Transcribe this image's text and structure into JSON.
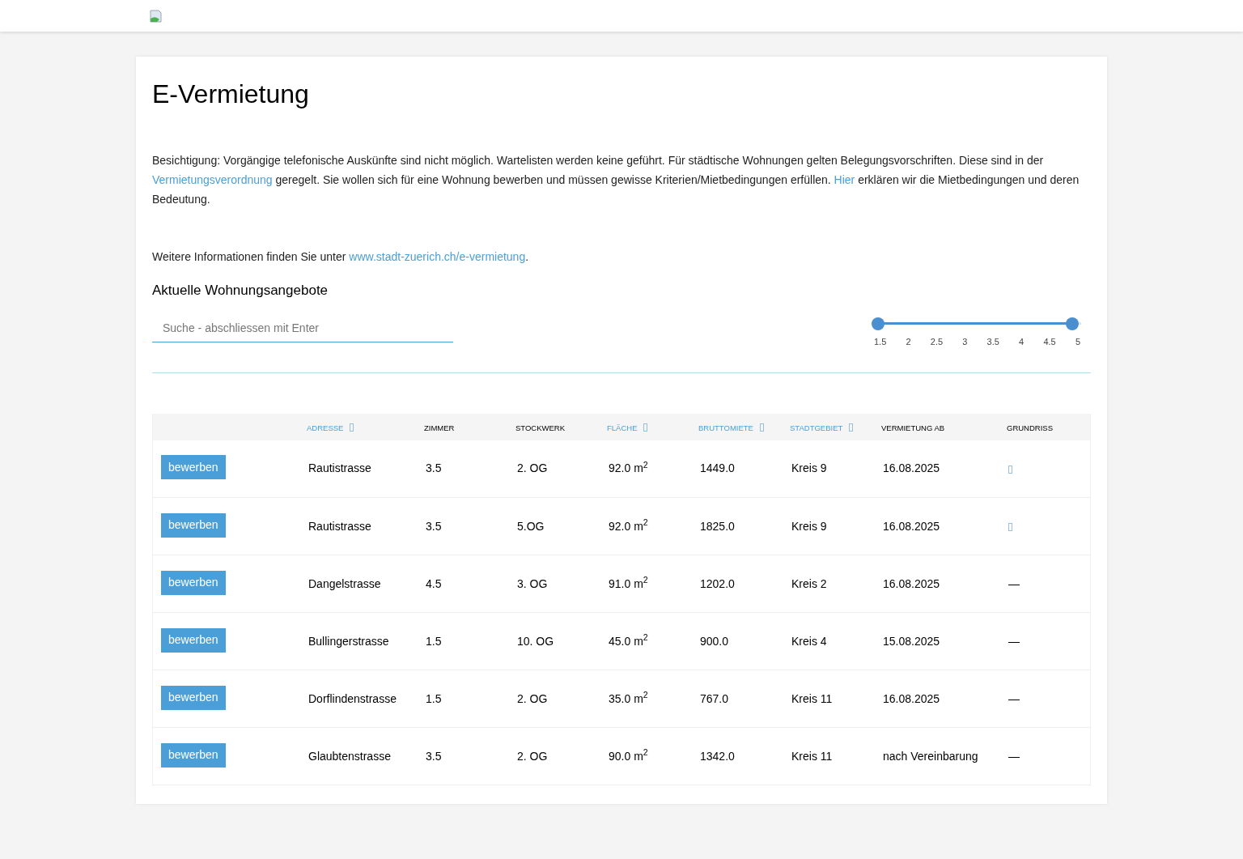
{
  "title": "E-Vermietung",
  "intro": [
    {
      "kind": "text",
      "text": "Besichtigung: Vorgängige telefonische Auskünfte sind nicht möglich. Wartelisten werden keine geführt. Für städtische Wohnungen gelten Belegungsvorschriften. Diese sind in der "
    },
    {
      "kind": "link",
      "text": "Vermietungsverordnung"
    },
    {
      "kind": "text",
      "text": " geregelt. Sie wollen sich für eine Wohnung bewerben und müssen gewisse Kriterien/Mietbedingungen erfüllen. "
    },
    {
      "kind": "link",
      "text": "Hier"
    },
    {
      "kind": "text",
      "text": " erklären wir die Mietbedingungen und deren Bedeutung."
    }
  ],
  "info": [
    {
      "kind": "text",
      "text": "Weitere Informationen finden Sie unter "
    },
    {
      "kind": "link",
      "text": "www.stadt-zuerich.ch/e-vermietung"
    },
    {
      "kind": "text",
      "text": "."
    }
  ],
  "section_title": "Aktuelle Wohnungsangebote",
  "search": {
    "placeholder": "Suche - abschliessen mit Enter"
  },
  "slider": {
    "low": {
      "level": 0
    },
    "high": {
      "level": 1
    },
    "ticks": [
      "1.5",
      "2",
      "2.5",
      "3",
      "3.5",
      "4",
      "4.5",
      "5"
    ]
  },
  "table": {
    "columns": [
      {
        "sortable": false
      },
      {
        "label": "ADRESSE",
        "sortable": true
      },
      {
        "label": "ZIMMER",
        "sortable": false
      },
      {
        "label": "STOCKWERK",
        "sortable": false
      },
      {
        "label": "FLÄCHE",
        "sortable": true
      },
      {
        "label": "BRUTTOMIETE",
        "sortable": true
      },
      {
        "label": "STADTGEBIET",
        "sortable": true
      },
      {
        "label": "VERMIETUNG AB",
        "sortable": false
      },
      {
        "label": "GRUNDRISS",
        "sortable": false
      }
    ],
    "rows": [
      {
        "cells": [
          {
            "kind": "button",
            "text": "bewerben"
          },
          {
            "kind": "text",
            "text": "Rautistrasse"
          },
          {
            "kind": "text",
            "text": "3.5"
          },
          {
            "kind": "text",
            "text": "2. OG"
          },
          {
            "kind": "text",
            "text": "92.0 m$^{2}$"
          },
          {
            "kind": "text",
            "text": "1449.0"
          },
          {
            "kind": "text",
            "text": "Kreis 9"
          },
          {
            "kind": "text",
            "text": "16.08.2025"
          },
          {
            "kind": "icon"
          }
        ]
      },
      {
        "cells": [
          {
            "kind": "button",
            "text": "bewerben"
          },
          {
            "kind": "text",
            "text": "Rautistrasse"
          },
          {
            "kind": "text",
            "text": "3.5"
          },
          {
            "kind": "text",
            "text": "5.OG"
          },
          {
            "kind": "text",
            "text": "92.0 m$^{2}$"
          },
          {
            "kind": "text",
            "text": "1825.0"
          },
          {
            "kind": "text",
            "text": "Kreis 9"
          },
          {
            "kind": "text",
            "text": "16.08.2025"
          },
          {
            "kind": "icon"
          }
        ]
      },
      {
        "cells": [
          {
            "kind": "button",
            "text": "bewerben"
          },
          {
            "kind": "text",
            "text": "Dangelstrasse"
          },
          {
            "kind": "text",
            "text": "4.5"
          },
          {
            "kind": "text",
            "text": "3. OG"
          },
          {
            "kind": "text",
            "text": "91.0 m$^{2}$"
          },
          {
            "kind": "text",
            "text": "1202.0"
          },
          {
            "kind": "text",
            "text": "Kreis 2"
          },
          {
            "kind": "text",
            "text": "16.08.2025"
          },
          {
            "kind": "text",
            "text": "—"
          }
        ]
      },
      {
        "cells": [
          {
            "kind": "button",
            "text": "bewerben"
          },
          {
            "kind": "text",
            "text": "Bullingerstrasse"
          },
          {
            "kind": "text",
            "text": "1.5"
          },
          {
            "kind": "text",
            "text": "10. OG"
          },
          {
            "kind": "text",
            "text": "45.0 m$^{2}$"
          },
          {
            "kind": "text",
            "text": "900.0"
          },
          {
            "kind": "text",
            "text": "Kreis 4"
          },
          {
            "kind": "text",
            "text": "15.08.2025"
          },
          {
            "kind": "text",
            "text": "—"
          }
        ]
      },
      {
        "cells": [
          {
            "kind": "button",
            "text": "bewerben"
          },
          {
            "kind": "text",
            "text": "Dorflindenstrasse"
          },
          {
            "kind": "text",
            "text": "1.5"
          },
          {
            "kind": "text",
            "text": "2. OG"
          },
          {
            "kind": "text",
            "text": "35.0 m$^{2}$"
          },
          {
            "kind": "text",
            "text": "767.0"
          },
          {
            "kind": "text",
            "text": "Kreis 11"
          },
          {
            "kind": "text",
            "text": "16.08.2025"
          },
          {
            "kind": "text",
            "text": "—"
          }
        ]
      },
      {
        "cells": [
          {
            "kind": "button",
            "text": "bewerben"
          },
          {
            "kind": "text",
            "text": "Glaubtenstrasse"
          },
          {
            "kind": "text",
            "text": "3.5"
          },
          {
            "kind": "text",
            "text": "2. OG"
          },
          {
            "kind": "text",
            "text": "90.0 m$^{2}$"
          },
          {
            "kind": "text",
            "text": "1342.0"
          },
          {
            "kind": "text",
            "text": "Kreis 11"
          },
          {
            "kind": "text",
            "text": "nach Vereinbarung"
          },
          {
            "kind": "text",
            "text": "—"
          }
        ]
      }
    ]
  }
}
